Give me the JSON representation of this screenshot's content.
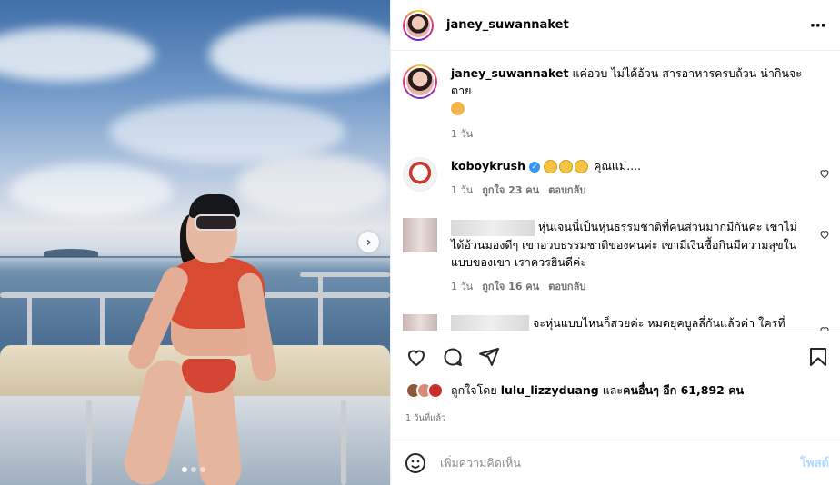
{
  "post": {
    "author": "janey_suwannaket",
    "caption_user": "janey_suwannaket",
    "caption": "แค่อวบ ไม่ได้อ้วน สารอาหารครบถ้วน น่ากินจะตาย",
    "caption_time": "1 วัน"
  },
  "comments": [
    {
      "username": "koboyk rush",
      "username_display": "koboykrush",
      "text": "คุณแม่....",
      "time": "1 วัน",
      "likes": "ถูกใจ 23 คน",
      "reply": "ตอบกลับ"
    },
    {
      "text": "หุ่นเจนนี่เป็นหุ่นธรรมชาติที่คนส่วนมากมีกันค่ะ เขาไม่ได้อ้วนมองดีๆ เขาอวบธรรมชาติของคนค่ะ เขามีเงินซื้อกินมีความสุขในแบบของเขา เราควรยินดีค่ะ",
      "time": "1 วัน",
      "likes": "ถูกใจ 16 คน",
      "reply": "ตอบกลับ"
    },
    {
      "text": "จะหุ่นแบบไหนก็สวยค่ะ หมดยุคบูลลี่กันแล้วค่า ใครที่แซะหุ่นเขายังงั้นยังงี้ นัดนี้ทัศนคติดีบ้างนะคะ คนแบบนี้toxicสุด"
    }
  ],
  "likes": {
    "prefix": "ถูกใจโดย",
    "user": "lulu_lizzyduang",
    "middle": "และ",
    "others": "คนอื่นๆ อีก 61,892 คน"
  },
  "date": "1 วันที่แล้ว",
  "input": {
    "placeholder": "เพิ่มความคิดเห็น",
    "post_label": "โพสต์"
  },
  "icons": {
    "more": "more-horizontal-icon",
    "like": "heart-icon",
    "comment": "comment-icon",
    "share": "send-icon",
    "save": "bookmark-icon",
    "emoji": "smile-icon",
    "next": "chevron-right-icon"
  },
  "colors": {
    "accent_post": "#b3dbff",
    "verified": "#3897f0",
    "meta_text": "#737373"
  },
  "carousel": {
    "total": 3,
    "active": 1
  }
}
